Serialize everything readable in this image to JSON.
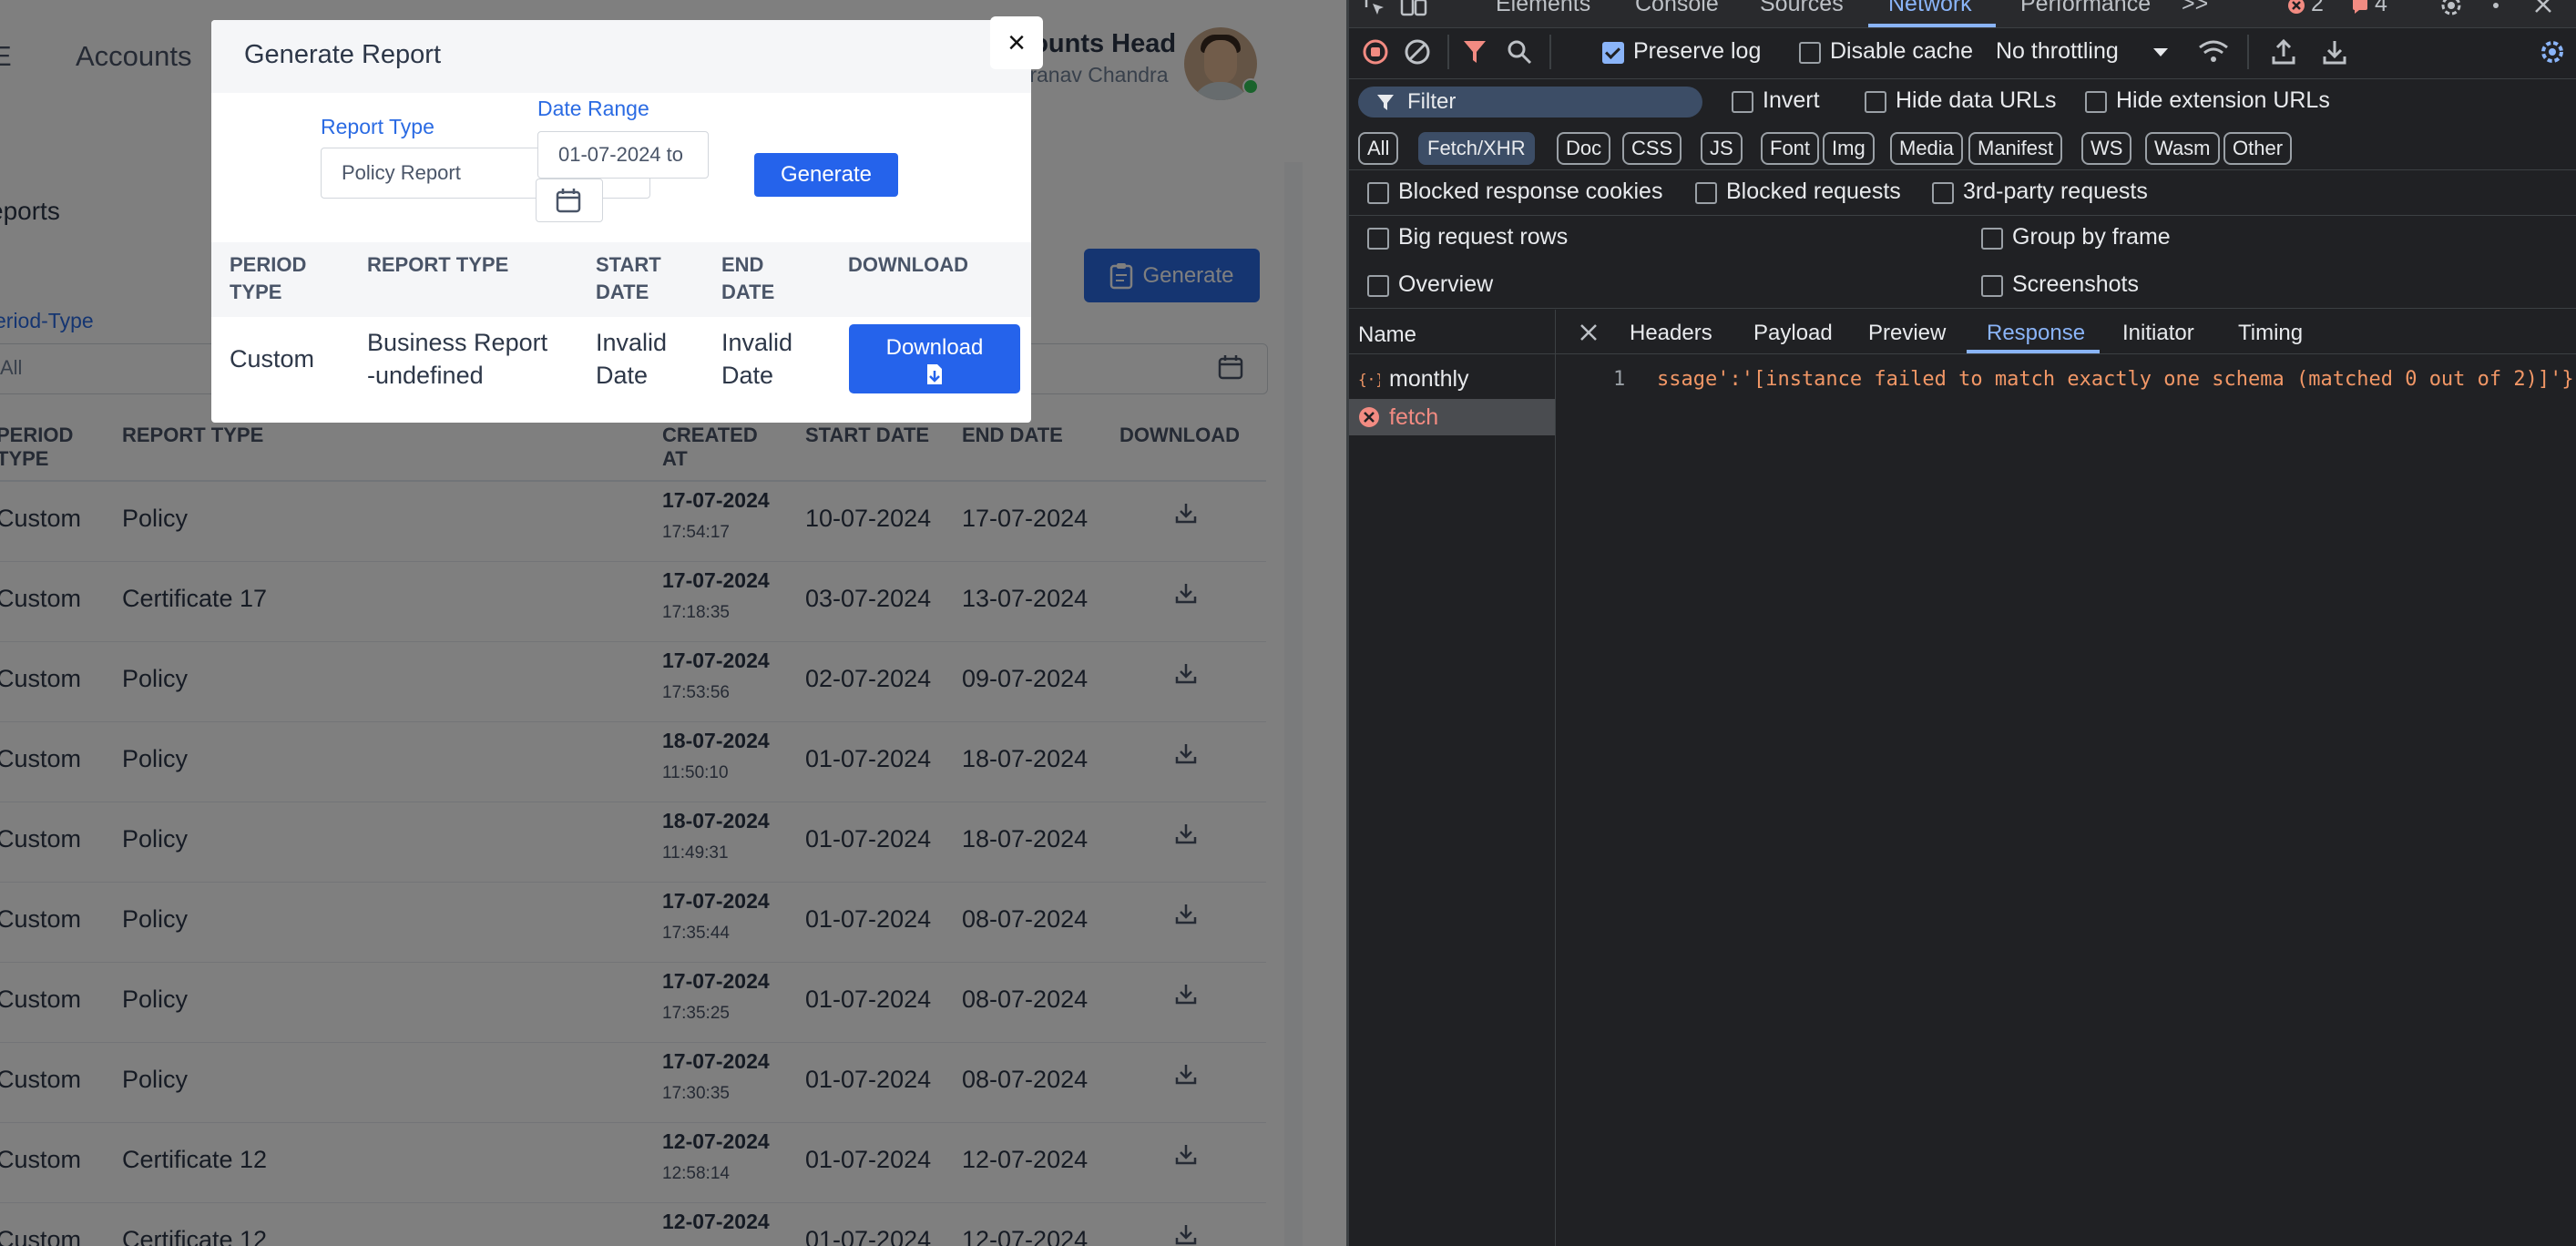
{
  "app": {
    "nav_menu_fragment": "E",
    "nav_accounts": "Accounts",
    "user_role": "Accounts Head",
    "user_name": "Pranav Chandra"
  },
  "page": {
    "title_fragment": "eports",
    "generate_button": "Generate",
    "period_type_label": "eriod-Type",
    "period_type_value": "All",
    "table_headers": [
      "PERIOD TYPE",
      "REPORT TYPE",
      "CREATED AT",
      "START DATE",
      "END DATE",
      "DOWNLOAD"
    ],
    "rows": [
      {
        "period": "Custom",
        "report": "Policy",
        "created_date": "17-07-2024",
        "created_time": "17:54:17",
        "start": "10-07-2024",
        "end": "17-07-2024"
      },
      {
        "period": "Custom",
        "report": "Certificate 17",
        "created_date": "17-07-2024",
        "created_time": "17:18:35",
        "start": "03-07-2024",
        "end": "13-07-2024"
      },
      {
        "period": "Custom",
        "report": "Policy",
        "created_date": "17-07-2024",
        "created_time": "17:53:56",
        "start": "02-07-2024",
        "end": "09-07-2024"
      },
      {
        "period": "Custom",
        "report": "Policy",
        "created_date": "18-07-2024",
        "created_time": "11:50:10",
        "start": "01-07-2024",
        "end": "18-07-2024"
      },
      {
        "period": "Custom",
        "report": "Policy",
        "created_date": "18-07-2024",
        "created_time": "11:49:31",
        "start": "01-07-2024",
        "end": "18-07-2024"
      },
      {
        "period": "Custom",
        "report": "Policy",
        "created_date": "17-07-2024",
        "created_time": "17:35:44",
        "start": "01-07-2024",
        "end": "08-07-2024"
      },
      {
        "period": "Custom",
        "report": "Policy",
        "created_date": "17-07-2024",
        "created_time": "17:35:25",
        "start": "01-07-2024",
        "end": "08-07-2024"
      },
      {
        "period": "Custom",
        "report": "Policy",
        "created_date": "17-07-2024",
        "created_time": "17:30:35",
        "start": "01-07-2024",
        "end": "08-07-2024"
      },
      {
        "period": "Custom",
        "report": "Certificate 12",
        "created_date": "12-07-2024",
        "created_time": "12:58:14",
        "start": "01-07-2024",
        "end": "12-07-2024"
      },
      {
        "period": "Custom",
        "report": "Certificate 12",
        "created_date": "12-07-2024",
        "created_time": "",
        "start": "01-07-2024",
        "end": "12-07-2024"
      }
    ]
  },
  "modal": {
    "title": "Generate Report",
    "close": "×",
    "report_type_label": "Report Type",
    "report_type_value": "Policy Report",
    "date_range_label": "Date Range",
    "date_range_value": "01-07-2024 to",
    "generate_button": "Generate",
    "headers": {
      "period_type_1": "PERIOD",
      "period_type_2": "TYPE",
      "report_type": "REPORT TYPE",
      "start_date_1": "START",
      "start_date_2": "DATE",
      "end_date_1": "END",
      "end_date_2": "DATE",
      "download": "DOWNLOAD"
    },
    "row": {
      "period": "Custom",
      "report_1": "Business Report",
      "report_2": "-undefined",
      "start_1": "Invalid",
      "start_2": "Date",
      "end_1": "Invalid",
      "end_2": "Date",
      "download": "Download"
    }
  },
  "devtools": {
    "tabs": [
      "Elements",
      "Console",
      "Sources",
      "Network",
      "Performance"
    ],
    "more_tabs": ">>",
    "error_count": "2",
    "warning_count": "4",
    "toolbar": {
      "preserve_log": "Preserve log",
      "disable_cache": "Disable cache",
      "throttling": "No throttling"
    },
    "filter": {
      "placeholder": "Filter",
      "invert": "Invert",
      "hide_data_urls": "Hide data URLs",
      "hide_extension_urls": "Hide extension URLs"
    },
    "type_chips": [
      "All",
      "Fetch/XHR",
      "Doc",
      "CSS",
      "JS",
      "Font",
      "Img",
      "Media",
      "Manifest",
      "WS",
      "Wasm",
      "Other"
    ],
    "options": {
      "blocked_cookies": "Blocked response cookies",
      "blocked_requests": "Blocked requests",
      "third_party": "3rd-party requests",
      "big_rows": "Big request rows",
      "group_by_frame": "Group by frame",
      "overview": "Overview",
      "screenshots": "Screenshots"
    },
    "name_header": "Name",
    "detail_tabs": [
      "Headers",
      "Payload",
      "Preview",
      "Response",
      "Initiator",
      "Timing"
    ],
    "requests": [
      "monthly",
      "fetch"
    ],
    "response_line_number": "1",
    "response_text": "ssage':'[instance failed to match exactly one schema (matched 0 out of 2)]'}",
    "colors": {
      "accent": "#8ab4f8",
      "error": "#f28b82",
      "response_text": "#f29766"
    }
  }
}
